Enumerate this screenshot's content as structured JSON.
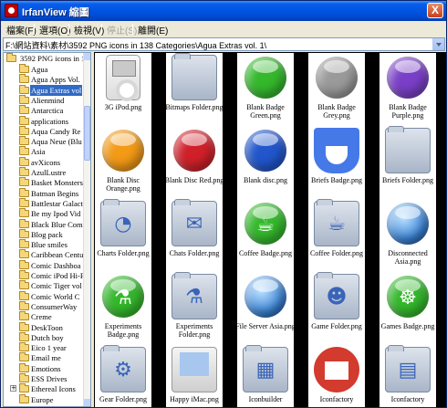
{
  "window": {
    "title": "IrfanView 縮圖",
    "close_glyph": "X"
  },
  "menu": [
    {
      "label": "檔案(F)",
      "disabled": false
    },
    {
      "label": "選項(O)",
      "disabled": false
    },
    {
      "label": "檢視(V)",
      "disabled": false
    },
    {
      "label": "停止(S)",
      "disabled": true
    },
    {
      "label": "離開(E)",
      "disabled": false
    }
  ],
  "path": {
    "value": "F:\\網站資料\\素材\\3592 PNG icons in 138 Categories\\Agua Extras vol. 1\\"
  },
  "tree": {
    "root": "3592 PNG icons in 1",
    "items": [
      "Agua",
      "Agua Apps Vol.",
      "Agua Extras vol",
      "Alienmind",
      "Antarctica",
      "applications",
      "Aqua Candy Re",
      "Aqua Neue (Blu",
      "Asia",
      "avXicons",
      "AzulLustre",
      "Basket Monsters",
      "Batman Begins",
      "Battlestar Galact",
      "Be my Ipod Vid",
      "Black Blue Comi",
      "Blog pack",
      "Blue smiles",
      "Caribbean Centu",
      "Comic Dashboa",
      "Comic iPod Hi-F",
      "Comic Tiger vol",
      "Comic World C",
      "ConsumerWay",
      "Creme",
      "DeskToon",
      "Dutch boy",
      "Eico 1 year",
      "Email me",
      "Emotions",
      "ESS Drives",
      "Ethereal Icons",
      "Europe"
    ],
    "selected_index": 2,
    "expandable_index": 31
  },
  "thumbnails": [
    {
      "label": "3G iPod.png",
      "icon": "ipod-icon"
    },
    {
      "label": "Bitmaps Folder.png",
      "icon": "folder-icon"
    },
    {
      "label": "Blank Badge Green.png",
      "icon": "green-orb-icon",
      "color": "#34b82c"
    },
    {
      "label": "Blank Badge Grey.png",
      "icon": "grey-orb-icon",
      "color": "#9a9a9a"
    },
    {
      "label": "Blank Badge Purple.png",
      "icon": "purple-orb-icon",
      "color": "#7a3fc7"
    },
    {
      "label": "Blank Disc Orange.png",
      "icon": "orange-disc-icon",
      "color": "#f39a16"
    },
    {
      "label": "Blank Disc Red.png",
      "icon": "red-disc-icon",
      "color": "#d0202a"
    },
    {
      "label": "Blank disc.png",
      "icon": "blue-disc-icon",
      "color": "#2156cc"
    },
    {
      "label": "Briefs Badge.png",
      "icon": "briefs-icon"
    },
    {
      "label": "Briefs Folder.png",
      "icon": "folder-icon"
    },
    {
      "label": "Charts Folder.png",
      "icon": "charts-folder-icon"
    },
    {
      "label": "Chats Folder.png",
      "icon": "chats-folder-icon"
    },
    {
      "label": "Coffee Badge.png",
      "icon": "coffee-orb-icon",
      "color": "#34b82c"
    },
    {
      "label": "Coffee Folder.png",
      "icon": "coffee-folder-icon"
    },
    {
      "label": "Disconnected Asia.png",
      "icon": "globe-icon"
    },
    {
      "label": "Experiments Badge.png",
      "icon": "experiments-orb-icon",
      "color": "#34b82c"
    },
    {
      "label": "Experiments Folder.png",
      "icon": "experiments-folder-icon"
    },
    {
      "label": "File Server Asia.png",
      "icon": "globe-icon"
    },
    {
      "label": "Game Folder.png",
      "icon": "game-folder-icon"
    },
    {
      "label": "Games Badge.png",
      "icon": "games-orb-icon",
      "color": "#34b82c"
    },
    {
      "label": "Gear Folder.png",
      "icon": "gear-folder-icon"
    },
    {
      "label": "Happy iMac.png",
      "icon": "imac-icon"
    },
    {
      "label": "Iconbuilder",
      "icon": "iconbuilder-icon"
    },
    {
      "label": "Iconfactory",
      "icon": "iconfactory-icon"
    },
    {
      "label": "Iconfactory",
      "icon": "iconfactory-folder-icon"
    }
  ]
}
